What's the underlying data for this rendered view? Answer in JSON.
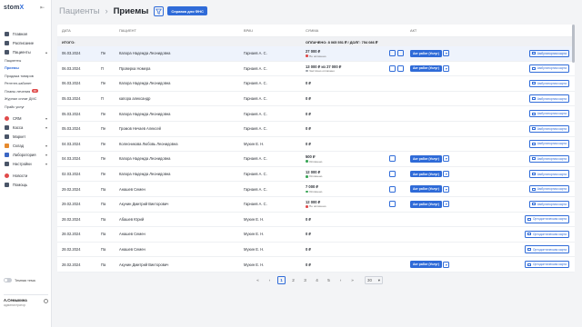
{
  "app": {
    "logo": "stom",
    "logo_x": "X"
  },
  "sidebar": {
    "items": [
      {
        "label": "Главная"
      },
      {
        "label": "Расписание"
      },
      {
        "label": "Пациенты",
        "expanded": true
      }
    ],
    "sub_items": [
      {
        "label": "Пациенты"
      },
      {
        "label": "Приемы",
        "active": true
      },
      {
        "label": "Продажа товаров"
      },
      {
        "label": "Рентген-кабинет"
      },
      {
        "label": "Планы лечения",
        "count": "40"
      },
      {
        "label": "Журнал оплат ДМС"
      },
      {
        "label": "Прайс услуг"
      }
    ],
    "items2": [
      {
        "label": "CRM"
      },
      {
        "label": "Касса"
      },
      {
        "label": "Маркет"
      },
      {
        "label": "Склад"
      },
      {
        "label": "Лаборатория"
      },
      {
        "label": "Настройки"
      },
      {
        "label": "Новости"
      },
      {
        "label": "Помощь"
      }
    ],
    "dark_mode_label": "Темная тема",
    "user_name": "А.Семыкина",
    "user_role": "администратор"
  },
  "header": {
    "crumb": "Пациенты",
    "title": "Приемы",
    "fns_button": "Справка для ФНС"
  },
  "table": {
    "columns": [
      "ДАТА",
      "",
      "ПАЦИЕНТ",
      "ВРАЧ",
      "СУММА",
      "",
      "АКТ",
      ""
    ],
    "totals": {
      "label": "ИТОГО:",
      "summary": "ОПЛАЧЕНО: 8 065 551 ₽ / ДОЛГ: 754 086 ₽"
    },
    "rows": [
      {
        "date": "06.03.2024",
        "type": "Пе",
        "patient": "Капора Надежда Леонидовна",
        "doctor": "Гарнаев А. С.",
        "sum": "27 000 ₽",
        "status": "Не оплачено",
        "status_color": "red",
        "icons": 2,
        "act": "Акт работ (Услуг)",
        "card": "Амбулаторная карта",
        "hl": true
      },
      {
        "date": "06.03.2024",
        "type": "П",
        "patient": "Проверка Номера",
        "doctor": "Гарнаев А. С.",
        "sum": "13 000 ₽ из 27 000 ₽",
        "status": "Частично оплачено",
        "status_color": "grey",
        "icons": 2,
        "act": "Акт работ (Услуг)",
        "card": "Амбулаторная карта"
      },
      {
        "date": "06.03.2024",
        "type": "Пе",
        "patient": "Капора Надежда Леонидовна",
        "doctor": "Гарнаев А. С.",
        "sum": "0 ₽",
        "status": "",
        "icons": 0,
        "act": "",
        "card": "Амбулаторная карта"
      },
      {
        "date": "05.03.2024",
        "type": "П",
        "patient": "капора александр",
        "doctor": "Гарнаев А. С.",
        "sum": "0 ₽",
        "status": "",
        "icons": 0,
        "act": "",
        "card": "Амбулаторная карта"
      },
      {
        "date": "05.03.2024",
        "type": "Пе",
        "patient": "Капора Надежда Леонидовна",
        "doctor": "Гарнаев А. С.",
        "sum": "0 ₽",
        "status": "",
        "icons": 0,
        "act": "",
        "card": "Амбулаторная карта"
      },
      {
        "date": "05.03.2024",
        "type": "Пе",
        "patient": "Громов Нечаев Алексей",
        "doctor": "Гарнаев А. С.",
        "sum": "0 ₽",
        "status": "",
        "icons": 0,
        "act": "",
        "card": "Амбулаторная карта"
      },
      {
        "date": "04.03.2024",
        "type": "Пе",
        "patient": "Колесникова Любовь Леонидовна",
        "doctor": "Мухин Е. Н.",
        "sum": "0 ₽",
        "status": "",
        "icons": 0,
        "act": "",
        "card": "Амбулаторная карта"
      },
      {
        "date": "04.03.2024",
        "type": "Пе",
        "patient": "Капора Надежда Леонидовна",
        "doctor": "Гарнаев А. С.",
        "sum": "500 ₽",
        "status": "Оплачено",
        "status_color": "green",
        "icons": 1,
        "act": "Акт работ (Услуг)",
        "card": "Амбулаторная карта"
      },
      {
        "date": "02.03.2024",
        "type": "Пе",
        "patient": "Капора Надежда Леонидовна",
        "doctor": "Гарнаев А. С.",
        "sum": "12 000 ₽",
        "status": "Оплачено",
        "status_color": "green",
        "icons": 1,
        "act": "Акт работ (Услуг)",
        "card": "Амбулаторная карта"
      },
      {
        "date": "29.02.2024",
        "type": "Па",
        "patient": "Анашев Семен",
        "doctor": "Гарнаев А. С.",
        "sum": "7 000 ₽",
        "status": "Оплачено",
        "status_color": "green",
        "icons": 1,
        "act": "Акт работ (Услуг)",
        "card": "Амбулаторная карта"
      },
      {
        "date": "29.02.2024",
        "type": "Па",
        "patient": "Акунин Дмитрий Викторович",
        "doctor": "Гарнаев А. С.",
        "sum": "12 000 ₽",
        "status": "Не оплачено",
        "status_color": "red",
        "icons": 1,
        "act": "Акт работ (Услуг)",
        "card": "Амбулаторная карта"
      },
      {
        "date": "28.02.2024",
        "type": "Па",
        "patient": "Абашев Юрий",
        "doctor": "Мухин Е. Н.",
        "sum": "0 ₽",
        "status": "",
        "icons": 0,
        "act": "",
        "card": "Ортодонтическая карта"
      },
      {
        "date": "28.02.2024",
        "type": "Па",
        "patient": "Анашев Семен",
        "doctor": "Мухин Е. Н.",
        "sum": "0 ₽",
        "status": "",
        "icons": 0,
        "act": "",
        "card": "Ортодонтическая карта"
      },
      {
        "date": "28.02.2024",
        "type": "Па",
        "patient": "Анашев Семен",
        "doctor": "Мухин Е. Н.",
        "sum": "0 ₽",
        "status": "",
        "icons": 0,
        "act": "",
        "card": "Ортодонтическая карта"
      },
      {
        "date": "28.02.2024",
        "type": "Па",
        "patient": "Акунин Дмитрий Викторович",
        "doctor": "Мухин Е. Н.",
        "sum": "0 ₽",
        "status": "",
        "icons": 0,
        "act": "Акт работ (Услуг)",
        "card": "Ортодонтическая карта"
      }
    ]
  },
  "pagination": {
    "pages": [
      "1",
      "2",
      "3",
      "4",
      "5"
    ],
    "active": "1",
    "page_size": "30"
  }
}
